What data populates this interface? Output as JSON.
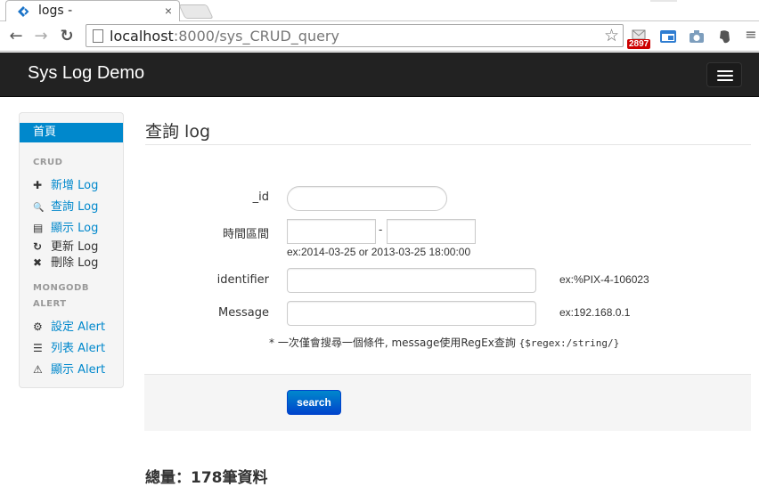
{
  "browser": {
    "tab_title": "logs -",
    "tab_close": "×",
    "url_host": "localhost",
    "url_rest": ":8000/sys_CRUD_query",
    "extension_badge": "2897",
    "back_glyph": "←",
    "forward_glyph": "→",
    "reload_glyph": "↻",
    "star_glyph": "☆"
  },
  "navbar": {
    "brand": "Sys Log Demo"
  },
  "sidebar": {
    "active_item": "首頁",
    "crud_header": "CRUD",
    "crud_items": [
      {
        "icon": "plus-icon",
        "glyph": "✚",
        "label": "新增 Log"
      },
      {
        "icon": "search-icon",
        "glyph": "🔍",
        "label": "查詢 Log"
      },
      {
        "icon": "list-icon",
        "glyph": "▤",
        "label": "顯示 Log"
      },
      {
        "icon": "refresh-icon",
        "glyph": "↻",
        "label": "更新 Log"
      },
      {
        "icon": "remove-icon",
        "glyph": "✖",
        "label": "刪除 Log"
      }
    ],
    "mongo_header_1": "MONGODB",
    "mongo_header_2": "ALERT",
    "alert_items": [
      {
        "icon": "gear-icon",
        "glyph": "⚙",
        "label": "設定 Alert"
      },
      {
        "icon": "list-icon",
        "glyph": "☰",
        "label": "列表 Alert"
      },
      {
        "icon": "warning-icon",
        "glyph": "⚠",
        "label": "顯示 Alert"
      }
    ]
  },
  "main": {
    "title": "查詢 log",
    "fields": {
      "id_label": "_id",
      "time_label": "時間區間",
      "time_separator": "-",
      "time_help": "ex:2014-03-25 or 2013-03-25 18:00:00",
      "identifier_label": "identifier",
      "identifier_help": "ex:%PIX-4-106023",
      "message_label": "Message",
      "message_help": "ex:192.168.0.1"
    },
    "note_text": "* 一次僅會搜尋一個條件, message使用RegEx查詢 ",
    "note_code": "{$regex:/string/}",
    "search_button": "search",
    "total_text": "總量：178筆資料"
  },
  "colors": {
    "navbar_bg": "#222222",
    "accent": "#0088cc",
    "button_dark": "#0044cc"
  }
}
